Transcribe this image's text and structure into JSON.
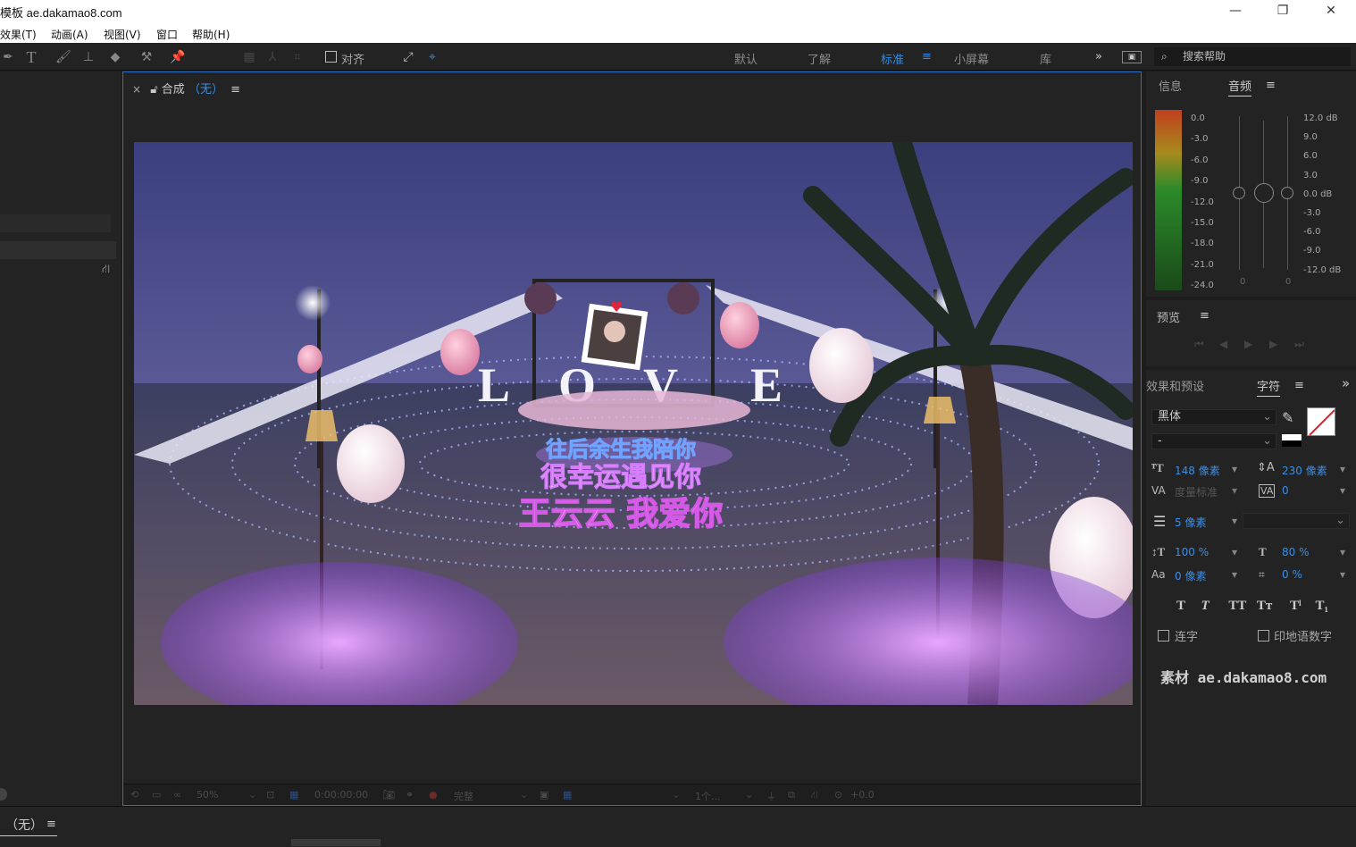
{
  "window": {
    "title": "模板 ae.dakamao8.com"
  },
  "menu": [
    "效果(T)",
    "动画(A)",
    "视图(V)",
    "窗口",
    "帮助(H)"
  ],
  "toolbar": {
    "align_label": "对齐"
  },
  "workspaces": [
    "默认",
    "了解",
    "标准",
    "小屏幕",
    "库"
  ],
  "workspace_active": "标准",
  "search": {
    "placeholder": "搜索帮助"
  },
  "composition": {
    "tab_label": "合成",
    "comp_name": "（无）"
  },
  "viewer": {
    "line1": "往后余生我陪你",
    "line2": "很幸运遇见你",
    "line3": "王云云  我爱你",
    "love_letters": [
      "L",
      "O",
      "V",
      "E"
    ]
  },
  "comp_footer": {
    "zoom": "50%",
    "timecode": "0:00:00:00",
    "resolution": "完整",
    "views": "1个...",
    "exposure": "+0.0"
  },
  "panels": {
    "info_tab": "信息",
    "audio_tab": "音频",
    "preview_tab": "预览",
    "effects_tab": "效果和预设",
    "character_tab": "字符"
  },
  "audio": {
    "left_scale": [
      "0.0",
      "-3.0",
      "-6.0",
      "-9.0",
      "-12.0",
      "-15.0",
      "-18.0",
      "-21.0",
      "-24.0"
    ],
    "right_scale": [
      "12.0 dB",
      "9.0",
      "6.0",
      "3.0",
      "0.0 dB",
      "-3.0",
      "-6.0",
      "-9.0",
      "-12.0 dB"
    ],
    "slider_values": [
      "0",
      "0"
    ]
  },
  "character": {
    "font": "黑体",
    "style": "-",
    "size": "148 像素",
    "leading": "230 像素",
    "kerning": "度量标准",
    "tracking": "0",
    "stroke": "5 像素",
    "vscale": "100 %",
    "hscale": "80 %",
    "baseline": "0 像素",
    "tsume": "0 %",
    "ligatures": "连字",
    "hindi_digits": "印地语数字",
    "watermark": "素材 ae.dakamao8.com"
  },
  "bottom": {
    "tab_label": "（无）"
  },
  "colors": {
    "accent": "#2d8ceb",
    "panel_bg": "#232323",
    "border_active": "#2d6fc0"
  }
}
